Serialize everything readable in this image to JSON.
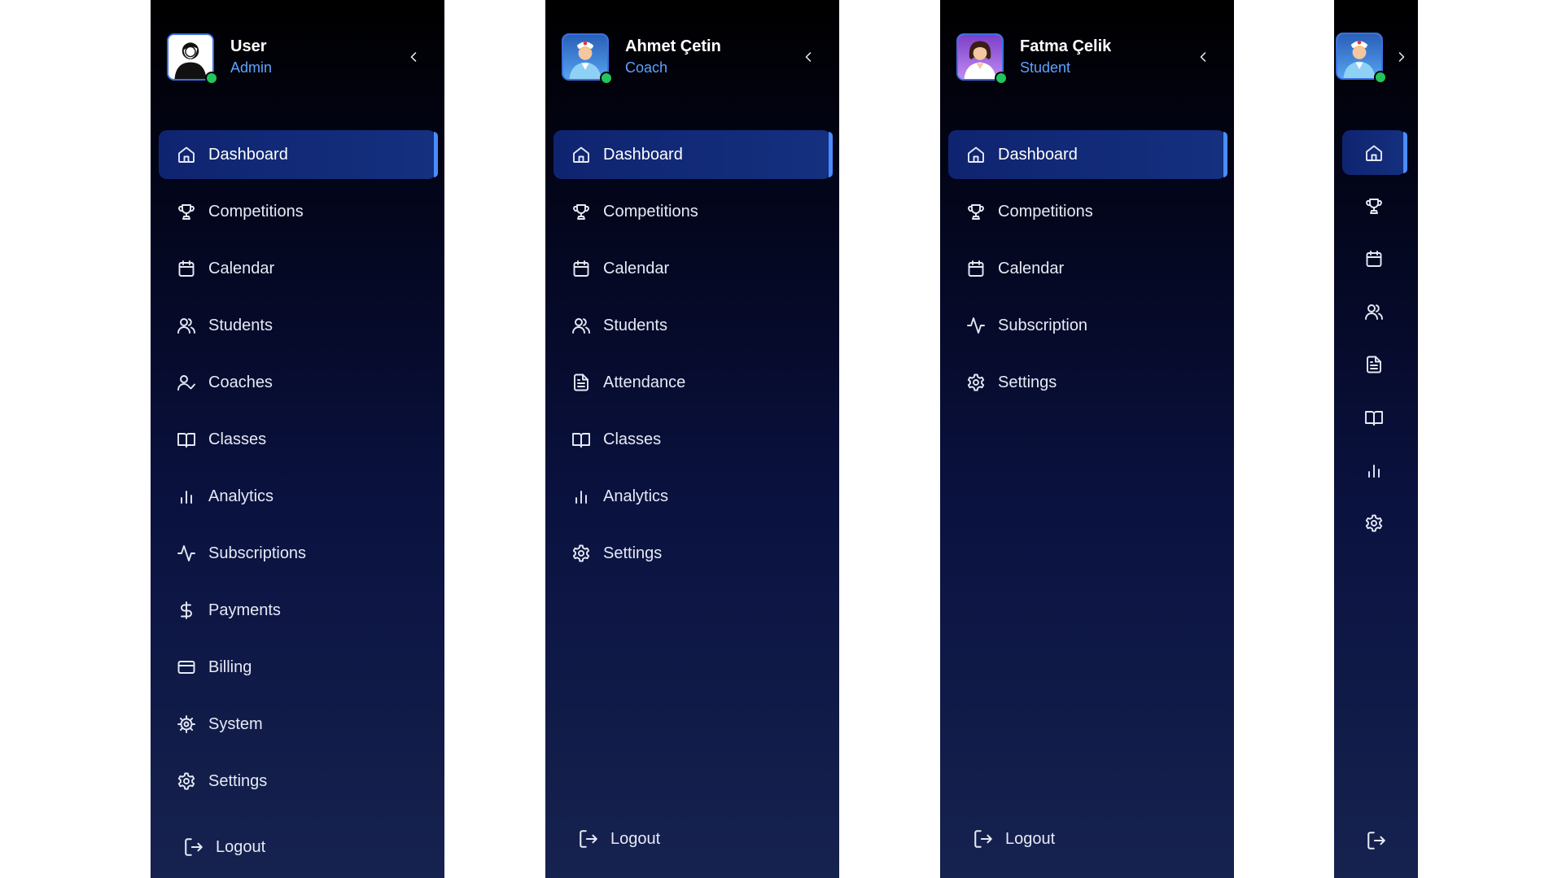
{
  "sidebars": {
    "admin": {
      "user": {
        "name": "User",
        "role": "Admin"
      },
      "nav": [
        {
          "label": "Dashboard",
          "icon": "home-icon",
          "active": true
        },
        {
          "label": "Competitions",
          "icon": "trophy-icon"
        },
        {
          "label": "Calendar",
          "icon": "calendar-icon"
        },
        {
          "label": "Students",
          "icon": "users-icon"
        },
        {
          "label": "Coaches",
          "icon": "user-check-icon"
        },
        {
          "label": "Classes",
          "icon": "book-open-icon"
        },
        {
          "label": "Analytics",
          "icon": "bar-chart-icon"
        },
        {
          "label": "Subscriptions",
          "icon": "activity-icon"
        },
        {
          "label": "Payments",
          "icon": "dollar-icon"
        },
        {
          "label": "Billing",
          "icon": "credit-card-icon"
        },
        {
          "label": "System",
          "icon": "cog-icon"
        },
        {
          "label": "Settings",
          "icon": "settings-icon"
        }
      ],
      "logout_label": "Logout"
    },
    "coach": {
      "user": {
        "name": "Ahmet Çetin",
        "role": "Coach"
      },
      "nav": [
        {
          "label": "Dashboard",
          "icon": "home-icon",
          "active": true
        },
        {
          "label": "Competitions",
          "icon": "trophy-icon"
        },
        {
          "label": "Calendar",
          "icon": "calendar-icon"
        },
        {
          "label": "Students",
          "icon": "users-icon"
        },
        {
          "label": "Attendance",
          "icon": "file-text-icon"
        },
        {
          "label": "Classes",
          "icon": "book-open-icon"
        },
        {
          "label": "Analytics",
          "icon": "bar-chart-icon"
        },
        {
          "label": "Settings",
          "icon": "settings-icon"
        }
      ],
      "logout_label": "Logout"
    },
    "student": {
      "user": {
        "name": "Fatma Çelik",
        "role": "Student"
      },
      "nav": [
        {
          "label": "Dashboard",
          "icon": "home-icon",
          "active": true
        },
        {
          "label": "Competitions",
          "icon": "trophy-icon"
        },
        {
          "label": "Calendar",
          "icon": "calendar-icon"
        },
        {
          "label": "Subscription",
          "icon": "activity-icon"
        },
        {
          "label": "Settings",
          "icon": "settings-icon"
        }
      ],
      "logout_label": "Logout"
    },
    "collapsed": {
      "nav_icons": [
        "home-icon",
        "trophy-icon",
        "calendar-icon",
        "users-icon",
        "file-text-icon",
        "book-open-icon",
        "bar-chart-icon",
        "settings-icon"
      ],
      "active_index": 0
    }
  },
  "colors": {
    "accent": "#4a8cff",
    "role_text": "#5ea2ff",
    "active_bg": "#14307f",
    "online": "#22c55e"
  }
}
